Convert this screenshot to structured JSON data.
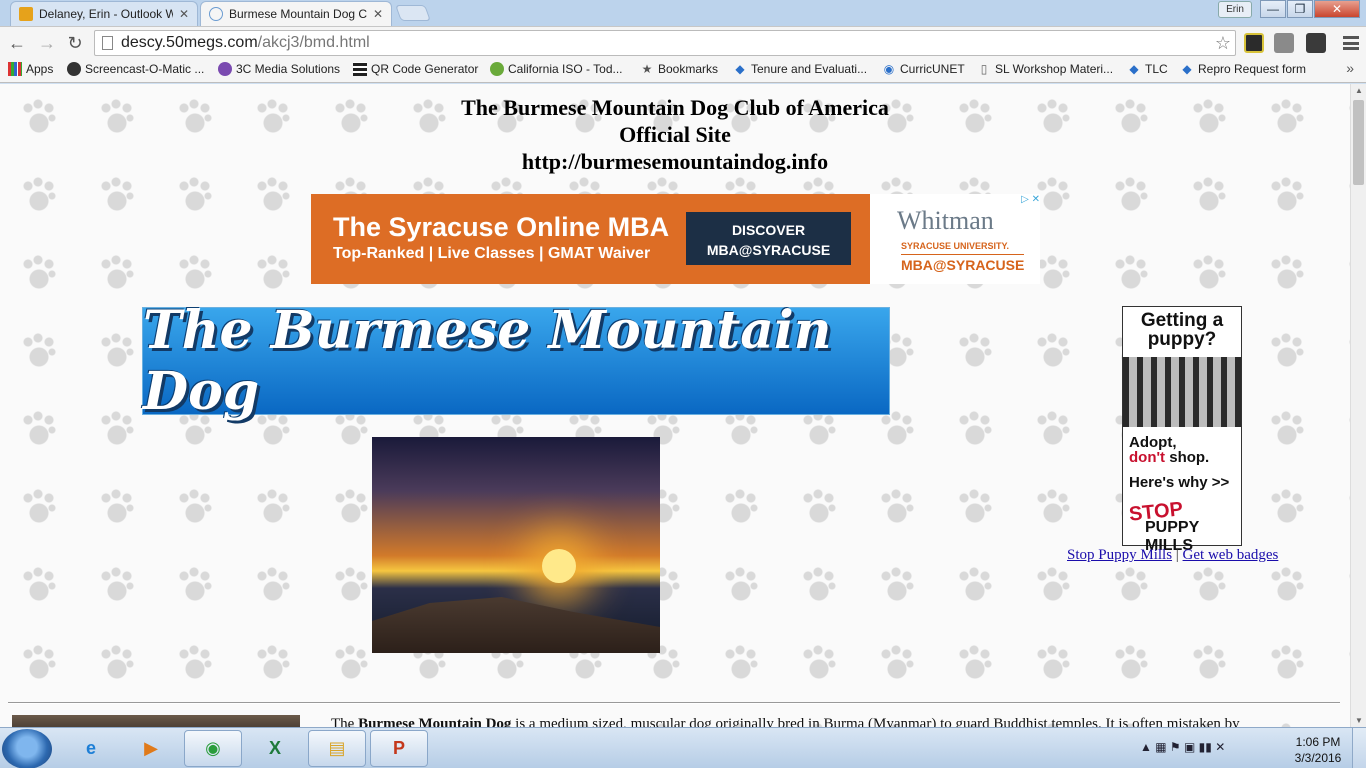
{
  "browser": {
    "tabs": [
      {
        "title": "Delaney, Erin - Outlook W",
        "icon": "outlook-icon",
        "active": false
      },
      {
        "title": "Burmese Mountain Dog Cl",
        "icon": "page-icon",
        "active": true
      }
    ],
    "user_badge": "Erin",
    "window_controls": {
      "minimize": "—",
      "maximize": "❐",
      "close": "✕"
    },
    "nav": {
      "back": "←",
      "forward": "→",
      "reload": "↻"
    },
    "address": {
      "host": "descy.50megs.com",
      "path": "/akcj3/bmd.html"
    },
    "bookmarks": [
      {
        "label": "Apps",
        "icon": "apps-grid-icon"
      },
      {
        "label": "Screencast-O-Matic ...",
        "icon": "screencast-icon"
      },
      {
        "label": "3C Media Solutions",
        "icon": "3c-media-icon"
      },
      {
        "label": "QR Code Generator",
        "icon": "qr-code-icon"
      },
      {
        "label": "California ISO - Tod...",
        "icon": "california-iso-icon"
      },
      {
        "label": "Bookmarks",
        "icon": "star-icon"
      },
      {
        "label": "Tenure and Evaluati...",
        "icon": "bookmark-icon"
      },
      {
        "label": "CurricUNET",
        "icon": "globe-icon"
      },
      {
        "label": "SL Workshop Materi...",
        "icon": "document-icon"
      },
      {
        "label": "TLC",
        "icon": "bookmark-icon"
      },
      {
        "label": "Repro Request form",
        "icon": "bookmark-icon"
      }
    ],
    "bookmarks_more": "»"
  },
  "page": {
    "title_lines": [
      "The Burmese Mountain Dog Club of America",
      "Official Site",
      "http://burmesemountaindog.info"
    ],
    "ad": {
      "headline": "The Syracuse Online MBA",
      "sub": "Top-Ranked  |  Live Classes  |  GMAT Waiver",
      "cta_line1": "DISCOVER",
      "cta_line2": "MBA@SYRACUSE",
      "brand": "Whitman",
      "brand_sub": "SYRACUSE UNIVERSITY.",
      "brand_tag": "MBA@SYRACUSE",
      "choices": "▷ ✕"
    },
    "banner_text": "The Burmese Mountain Dog",
    "puppy_ad": {
      "head": "Getting a puppy?",
      "adopt": "Adopt,",
      "dont": "don't",
      "shop": " shop.",
      "why": "Here's why >>",
      "stop": "STOP",
      "mills": "PUPPY MILLS"
    },
    "puppy_links": {
      "link1": "Stop Puppy Mills",
      "sep": " | ",
      "link2": "Get web badges"
    },
    "intro": {
      "prefix": "The ",
      "bold": "Burmese Mountain Dog",
      "rest": " is a medium sized, muscular dog originally bred in Burma (Myanmar) to guard Buddhist temples. It is often mistaken by"
    }
  },
  "taskbar": {
    "apps": [
      {
        "name": "ie",
        "glyph": "e",
        "color": "#1e7fd6"
      },
      {
        "name": "media",
        "glyph": "▶",
        "color": "#e07a1a"
      },
      {
        "name": "chrome",
        "glyph": "◉",
        "color": "#2a9d3c"
      },
      {
        "name": "excel",
        "glyph": "X",
        "color": "#1e7a3a"
      },
      {
        "name": "explorer",
        "glyph": "▤",
        "color": "#d9a52a"
      },
      {
        "name": "powerpoint",
        "glyph": "P",
        "color": "#c4381c"
      }
    ],
    "tray_icons": "▲  ▦  ⚑  ▣  ▮▮  ✕",
    "time": "1:06 PM",
    "date": "3/3/2016"
  }
}
